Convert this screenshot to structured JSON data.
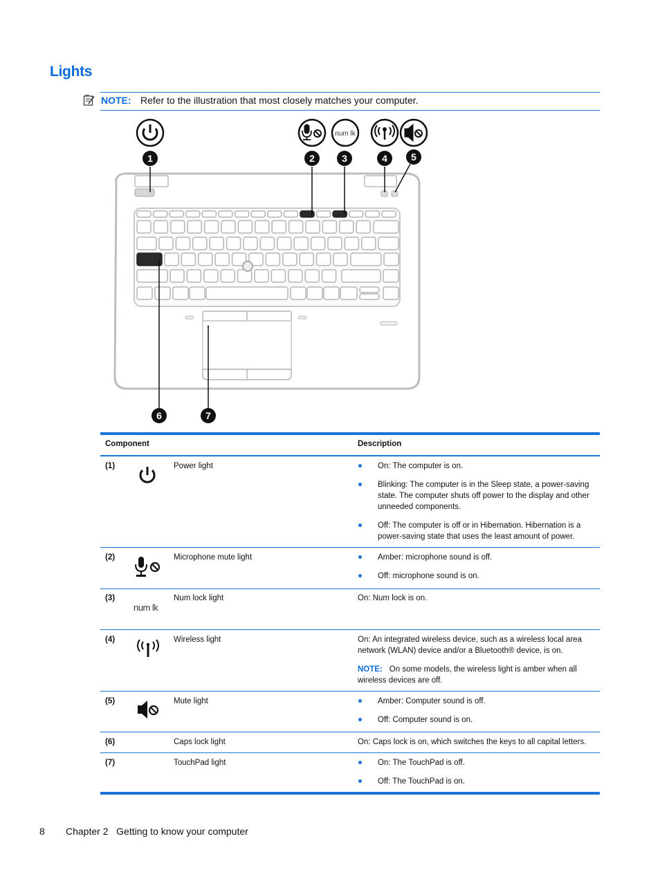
{
  "page": {
    "title": "Lights",
    "note": {
      "label": "NOTE:",
      "text": "Refer to the illustration that most closely matches your computer."
    },
    "illustration": {
      "callouts": [
        "1",
        "2",
        "3",
        "4",
        "5",
        "6",
        "7"
      ],
      "numlock_icon_text": "num lk"
    },
    "table": {
      "headers": {
        "component": "Component",
        "description": "Description"
      },
      "accent_color": "#1a73d9",
      "rows": [
        {
          "num": "(1)",
          "icon": "power-icon",
          "name": "Power light",
          "bullets": [
            "On: The computer is on.",
            "Blinking: The computer is in the Sleep state, a power-saving state. The computer shuts off power to the display and other unneeded components.",
            "Off: The computer is off or in Hibernation. Hibernation is a power-saving state that uses the least amount of power."
          ]
        },
        {
          "num": "(2)",
          "icon": "microphone-mute-icon",
          "name": "Microphone mute light",
          "bullets": [
            "Amber: microphone sound is off.",
            "Off: microphone sound is on."
          ]
        },
        {
          "num": "(3)",
          "icon": "num-lock-icon",
          "icon_text": "num lk",
          "name": "Num lock light",
          "text": "On: Num lock is on."
        },
        {
          "num": "(4)",
          "icon": "wireless-icon",
          "name": "Wireless light",
          "text": "On: An integrated wireless device, such as a wireless local area network (WLAN) device and/or a Bluetooth® device, is on.",
          "note_label": "NOTE:",
          "note_text": "On some models, the wireless light is amber when all wireless devices are off."
        },
        {
          "num": "(5)",
          "icon": "mute-icon",
          "name": "Mute light",
          "bullets": [
            "Amber: Computer sound is off.",
            "Off: Computer sound is on."
          ]
        },
        {
          "num": "(6)",
          "name": "Caps lock light",
          "text": "On: Caps lock is on, which switches the keys to all capital letters."
        },
        {
          "num": "(7)",
          "name": "TouchPad light",
          "bullets": [
            "On: The TouchPad is off.",
            "Off: The TouchPad is on."
          ]
        }
      ]
    },
    "footer": {
      "page_number": "8",
      "chapter": "Chapter 2   Getting to know your computer"
    }
  }
}
